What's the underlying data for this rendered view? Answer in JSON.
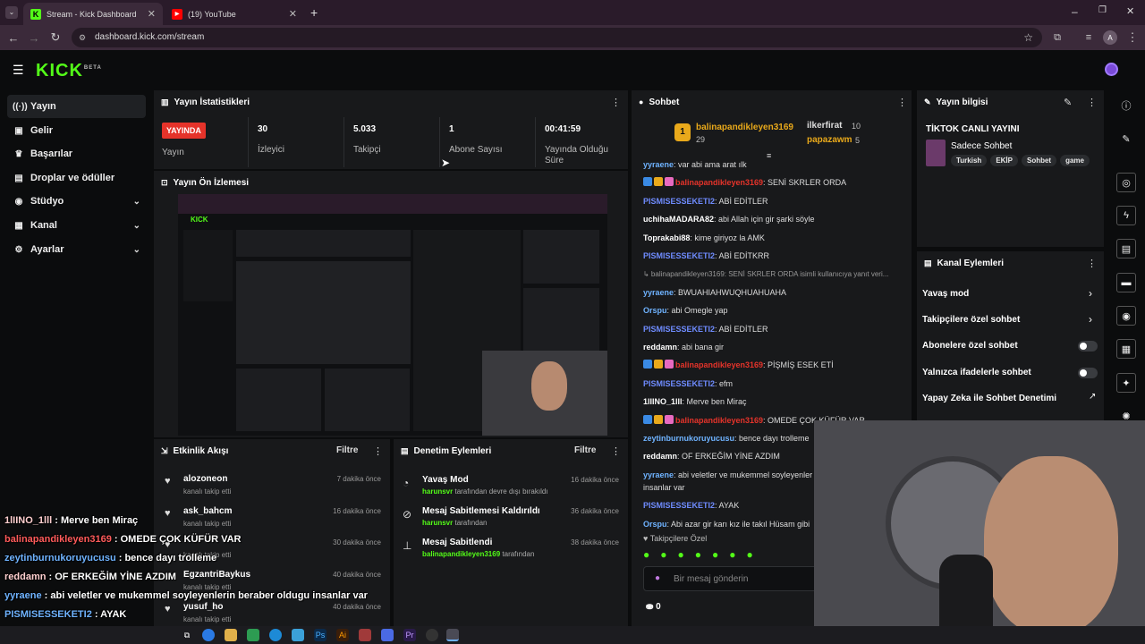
{
  "browser": {
    "tabs": [
      {
        "title": "Stream - Kick Dashboard",
        "favicon": "kick-icon",
        "active": true
      },
      {
        "title": "(19) YouTube",
        "favicon": "youtube-icon",
        "active": false
      }
    ],
    "url": "dashboard.kick.com/stream",
    "profile_initial": "A"
  },
  "sidebar": {
    "items": [
      {
        "label": "Yayın",
        "icon": "broadcast-icon"
      },
      {
        "label": "Gelir",
        "icon": "revenue-icon"
      },
      {
        "label": "Başarılar",
        "icon": "trophy-icon"
      },
      {
        "label": "Droplar ve ödüller",
        "icon": "gift-icon"
      },
      {
        "label": "Stüdyo",
        "icon": "studio-icon"
      },
      {
        "label": "Kanal",
        "icon": "channel-icon"
      },
      {
        "label": "Ayarlar",
        "icon": "settings-icon"
      }
    ]
  },
  "stats": {
    "title": "Yayın İstatistikleri",
    "live_badge": "YAYINDA",
    "live_label": "Yayın",
    "viewers": "30",
    "viewers_label": "İzleyici",
    "followers": "5.033",
    "followers_label": "Takipçi",
    "subs": "1",
    "subs_label": "Abone Sayısı",
    "uptime": "00:41:59",
    "uptime_label": "Yayında Olduğu Süre"
  },
  "preview": {
    "title": "Yayın Ön İzlemesi"
  },
  "activity": {
    "title": "Etkinlik Akışı",
    "filter": "Filtre",
    "rows": [
      {
        "name": "alozoneon",
        "sub": "kanalı takip etti",
        "time": "7 dakika önce"
      },
      {
        "name": "ask_bahcm",
        "sub": "kanalı takip etti",
        "time": "16 dakika önce"
      },
      {
        "name": "",
        "sub": "kanalı takip etti",
        "time": "30 dakika önce"
      },
      {
        "name": "EgzantriBaykus",
        "sub": "kanalı takip etti",
        "time": "40 dakika önce"
      },
      {
        "name": "yusuf_ho",
        "sub": "kanalı takip etti",
        "time": "40 dakika önce"
      }
    ]
  },
  "moderation": {
    "title": "Denetim Eylemleri",
    "filter": "Filtre",
    "rows": [
      {
        "name": "Yavaş Mod",
        "user": "harunsvr",
        "sub": "tarafından devre dışı bırakıldı",
        "time": "16 dakika önce",
        "icon": "slow-mode-icon"
      },
      {
        "name": "Mesaj Sabitlemesi Kaldırıldı",
        "user": "harunsvr",
        "sub": "tarafından",
        "time": "36 dakika önce",
        "icon": "unpin-icon"
      },
      {
        "name": "Mesaj Sabitlendi",
        "user": "balinapandikleyen3169",
        "sub": "tarafından",
        "time": "38 dakika önce",
        "icon": "pin-icon"
      }
    ]
  },
  "chat": {
    "title": "Sohbet",
    "top_gifters": [
      {
        "rank": "1",
        "name": "balinapandikleyen3169",
        "count": "29"
      },
      {
        "name": "ilkerfirat",
        "count": "10"
      },
      {
        "name": "papazawm",
        "count": "5"
      }
    ],
    "messages": [
      {
        "user": "yyraene",
        "text": ": var abi ama arat ılk",
        "color": "#6fb3ff"
      },
      {
        "user": "balinapandikleyen3169",
        "text": ": SENİ SKRLER ORDA",
        "color": "#e5332a",
        "badges": true
      },
      {
        "user": "PISMISESSEKETI2",
        "text": ": ABİ EDİTLER",
        "color": "#6f8cff"
      },
      {
        "user": "uchihaMADARA82",
        "text": ": abi Allah için gir şarki söyle",
        "color": "#ffffff"
      },
      {
        "user": "Toprakabi88",
        "text": ": kime giriyoz la AMK",
        "color": "#ffffff"
      },
      {
        "user": "PISMISESSEKETI2",
        "text": ": ABİ EDİTKRR",
        "color": "#6f8cff"
      },
      {
        "user": "",
        "text": "↳ balinapandikleyen3169: SENİ SKRLER ORDA isimli kullanıcıya yanıt veri...",
        "color": "#999999",
        "reply": true
      },
      {
        "user": "yyraene",
        "text": ": BWUAHIAHWUQHUAHUAHA",
        "color": "#6fb3ff"
      },
      {
        "user": "Orspu",
        "text": ": abi Omegle yap",
        "color": "#6fb3ff"
      },
      {
        "user": "PISMISESSEKETI2",
        "text": ": ABİ EDİTLER",
        "color": "#6f8cff"
      },
      {
        "user": "reddamn",
        "text": ": abi bana gir",
        "color": "#ffffff"
      },
      {
        "user": "balinapandikleyen3169",
        "text": ": PİŞMİŞ ESEK ETİ",
        "color": "#e5332a",
        "badges": true
      },
      {
        "user": "PISMISESSEKETI2",
        "text": ": efm",
        "color": "#6f8cff"
      },
      {
        "user": "1lIINO_1lll",
        "text": ": Merve ben Miraç",
        "color": "#ffffff"
      },
      {
        "user": "balinapandikleyen3169",
        "text": ": OMEDE ÇOK KÜFÜR VAR",
        "color": "#e5332a",
        "badges": true
      },
      {
        "user": "zeytinburnukoruyucusu",
        "text": ": bence dayı trolleme",
        "color": "#6fb3ff"
      },
      {
        "user": "reddamn",
        "text": ": OF ERKEĞİM YİNE AZDIM",
        "color": "#ffffff"
      },
      {
        "user": "yyraene",
        "text": ": abi veletler ve mukemmel soyleyenler",
        "color": "#6fb3ff"
      },
      {
        "user": "",
        "text": "insanlar var",
        "color": "#dddddd"
      },
      {
        "user": "PISMISESSEKETI2",
        "text": ": AYAK",
        "color": "#6f8cff"
      },
      {
        "user": "Orspu",
        "text": ": Abi azar gir karı kız ile takıl Hüsam gibi",
        "color": "#6fb3ff"
      }
    ],
    "followers_only": "Takipçilere Özel",
    "input_placeholder": "Bir mesaj gönderin",
    "points": "0"
  },
  "stream_info": {
    "title": "Yayın bilgisi",
    "stream_title": "TİKTOK CANLI YAYINI",
    "category": "Sadece Sohbet",
    "tags": [
      "Turkish",
      "EKİP",
      "Sohbet",
      "game"
    ]
  },
  "channel_actions": {
    "title": "Kanal Eylemleri",
    "items": [
      {
        "label": "Yavaş mod",
        "control": "arrow"
      },
      {
        "label": "Takipçilere özel sohbet",
        "control": "arrow"
      },
      {
        "label": "Abonelere özel sohbet",
        "control": "toggle"
      },
      {
        "label": "Yalnızca ifadelerle sohbet",
        "control": "toggle"
      },
      {
        "label": "Yapay Zeka ile Sohbet Denetimi",
        "control": "external"
      }
    ]
  },
  "overlay_chat": [
    {
      "user": "1lIINO_1lll",
      "text": " : Merve ben Miraç"
    },
    {
      "user": "balinapandikleyen3169",
      "text": " : OMEDE ÇOK KÜFÜR VAR"
    },
    {
      "user": "zeytinburnukoruyucusu",
      "text": " : bence dayı trolleme"
    },
    {
      "user": "reddamn",
      "text": " : OF ERKEĞİM YİNE AZDIM"
    },
    {
      "user": "yyraene",
      "text": " : abi veletler ve mukemmel soyleyenlerin beraber oldugu insanlar var"
    },
    {
      "user": "PISMISESSEKETI2",
      "text": " : AYAK"
    },
    {
      "user": "",
      "text": "karı kız ile takıl Husam gibi"
    }
  ],
  "colors": {
    "accent": "#53fc18",
    "live": "#e5332a",
    "panel": "#18191b",
    "bg": "#0b0c0d"
  }
}
